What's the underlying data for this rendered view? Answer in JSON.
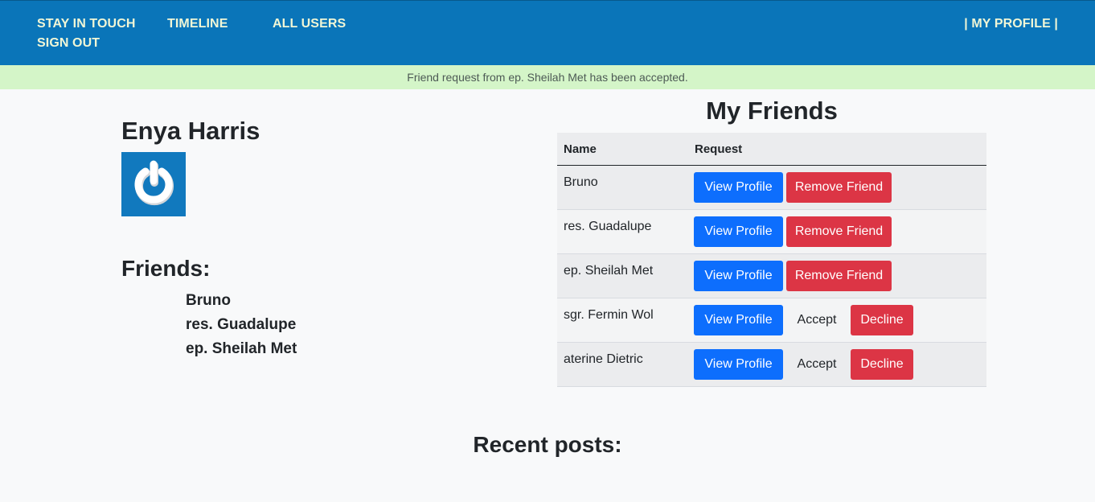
{
  "nav": {
    "stay_in_touch": "STAY IN TOUCH",
    "timeline": "TIMELINE",
    "all_users": "ALL USERS",
    "sign_out": "SIGN OUT",
    "my_profile": "| MY PROFILE |"
  },
  "alert": {
    "message": "Friend request from ep. Sheilah Met has been accepted."
  },
  "profile": {
    "name": "Enya Harris",
    "avatar_icon": "power-icon",
    "friends_heading": "Friends:",
    "friends": [
      "Bruno",
      "res. Guadalupe",
      "ep. Sheilah Met"
    ]
  },
  "my_friends": {
    "title": "My Friends",
    "columns": [
      "Name",
      "Request"
    ],
    "rows": [
      {
        "name": "Bruno",
        "view": "View Profile",
        "remove": "Remove Friend"
      },
      {
        "name": "res. Guadalupe",
        "view": "View Profile",
        "remove": "Remove Friend"
      },
      {
        "name": "ep. Sheilah Met",
        "view": "View Profile",
        "remove": "Remove Friend"
      },
      {
        "name": "sgr. Fermin Wol",
        "view": "View Profile",
        "accept": "Accept",
        "decline": "Decline"
      },
      {
        "name": "aterine Dietric",
        "view": "View Profile",
        "accept": "Accept",
        "decline": "Decline"
      }
    ]
  },
  "posts": {
    "heading": "Recent posts:"
  },
  "colors": {
    "navbar": "#0a75b9",
    "alert_bg": "#d4f5c8",
    "primary": "#0d6efd",
    "danger": "#dc3545"
  }
}
